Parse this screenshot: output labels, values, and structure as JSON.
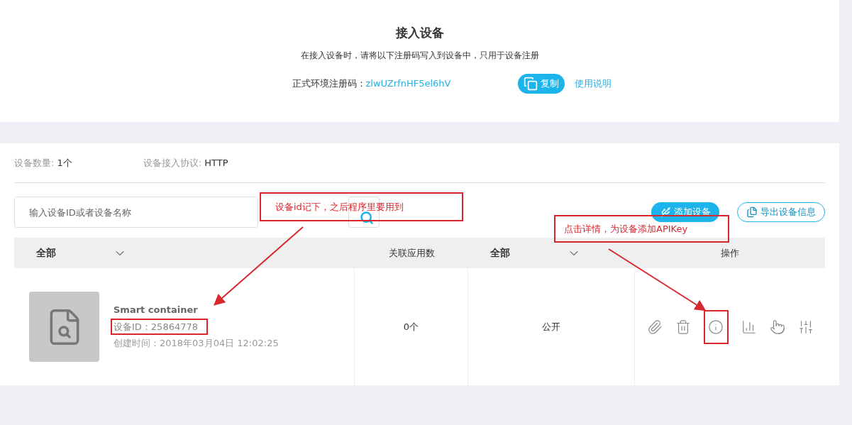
{
  "header": {
    "title": "接入设备",
    "subtitle": "在接入设备时，请将以下注册码写入到设备中，只用于设备注册",
    "code_label": "正式环境注册码：",
    "code": "zlwUZrfnHF5el6hV",
    "copy_button": "复制",
    "help_link": "使用说明"
  },
  "stats": [
    {
      "label": "设备数量:",
      "value": "1个"
    },
    {
      "label": "设备接入协议:",
      "value": "HTTP"
    }
  ],
  "search": {
    "placeholder": "输入设备ID或者设备名称"
  },
  "buttons": [
    {
      "label": "添加设备",
      "kind": "filled"
    },
    {
      "label": "导出设备信息",
      "kind": "outline"
    }
  ],
  "table": {
    "columns": [
      {
        "label": "全部",
        "kind": "dropdown"
      },
      {
        "label": "关联应用数",
        "kind": "text"
      },
      {
        "label": "全部",
        "kind": "dropdown"
      },
      {
        "label": "操作",
        "kind": "text"
      }
    ],
    "rows": [
      {
        "name": "Smart container",
        "device_id": "设备ID：25864778",
        "created": "创建时间：2018年03月04日 12:02:25",
        "apps": "0个",
        "visibility": "公开",
        "actions": [
          {
            "kind": "attach"
          },
          {
            "kind": "delete"
          },
          {
            "kind": "info"
          },
          {
            "kind": "data"
          },
          {
            "kind": "command"
          },
          {
            "kind": "settings"
          }
        ]
      }
    ]
  },
  "annotations": [
    {
      "text": "设备id记下，之后程序里要用到"
    },
    {
      "text": "点击详情，为设备添加APIKey"
    }
  ]
}
